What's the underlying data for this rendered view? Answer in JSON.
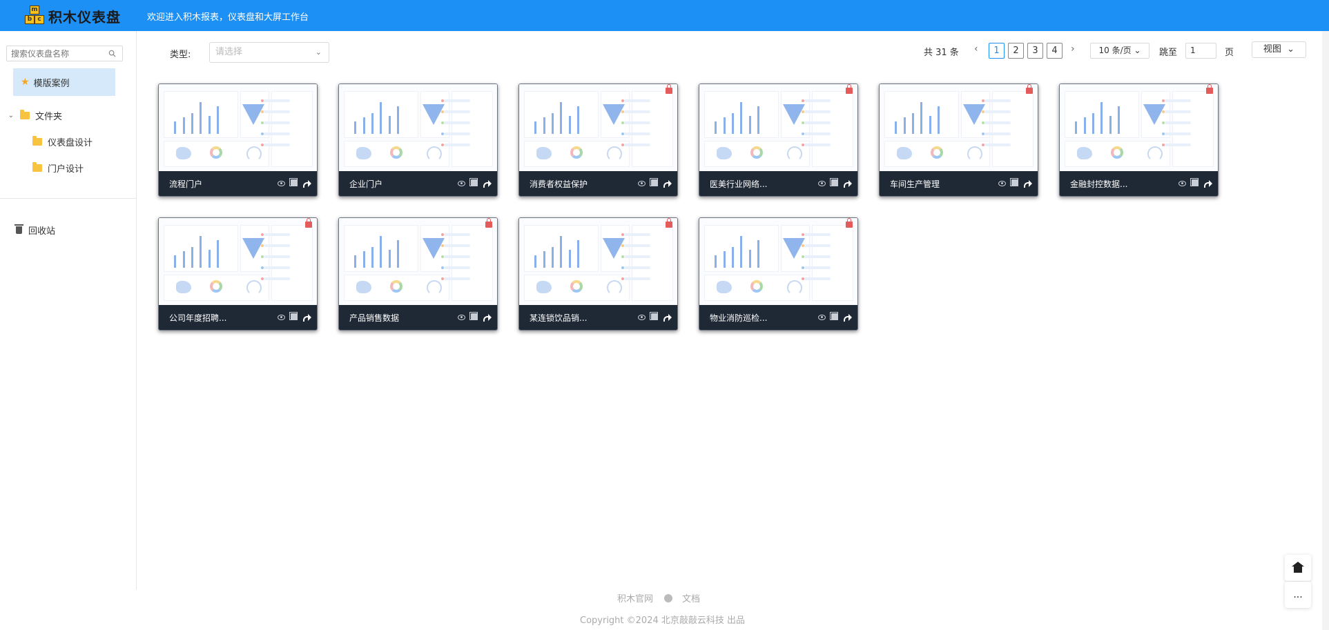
{
  "header": {
    "logo_text": "积木仪表盘",
    "logo_blocks": [
      "m",
      "b",
      "c"
    ],
    "welcome": "欢迎进入积木报表，仪表盘和大屏工作台"
  },
  "sidebar": {
    "search_placeholder": "搜索仪表盘名称",
    "template_label": "模版案例",
    "folder_label": "文件夹",
    "folders": [
      "仪表盘设计",
      "门户设计"
    ],
    "recycle_label": "回收站"
  },
  "toolbar": {
    "type_label": "类型:",
    "type_placeholder": "请选择",
    "total": "共 31 条",
    "pages": [
      "1",
      "2",
      "3",
      "4"
    ],
    "current_page": "1",
    "page_size": "10 条/页",
    "jump_label": "跳至",
    "jump_value": "1",
    "page_unit": "页",
    "view_label": "视图"
  },
  "cards": [
    {
      "title": "流程门户",
      "locked": false
    },
    {
      "title": "企业门户",
      "locked": false
    },
    {
      "title": "消费者权益保护",
      "locked": true
    },
    {
      "title": "医美行业网络...",
      "locked": true
    },
    {
      "title": "车间生产管理",
      "locked": true
    },
    {
      "title": "金融封控数据...",
      "locked": true
    },
    {
      "title": "公司年度招聘...",
      "locked": true
    },
    {
      "title": "产品销售数据",
      "locked": true
    },
    {
      "title": "某连锁饮品销...",
      "locked": true
    },
    {
      "title": "物业消防巡检...",
      "locked": true
    }
  ],
  "footer": {
    "official_site": "积木官网",
    "docs": "文档",
    "copyright": "Copyright ©2024 北京敲敲云科技 出品"
  },
  "float": {
    "more": "..."
  }
}
